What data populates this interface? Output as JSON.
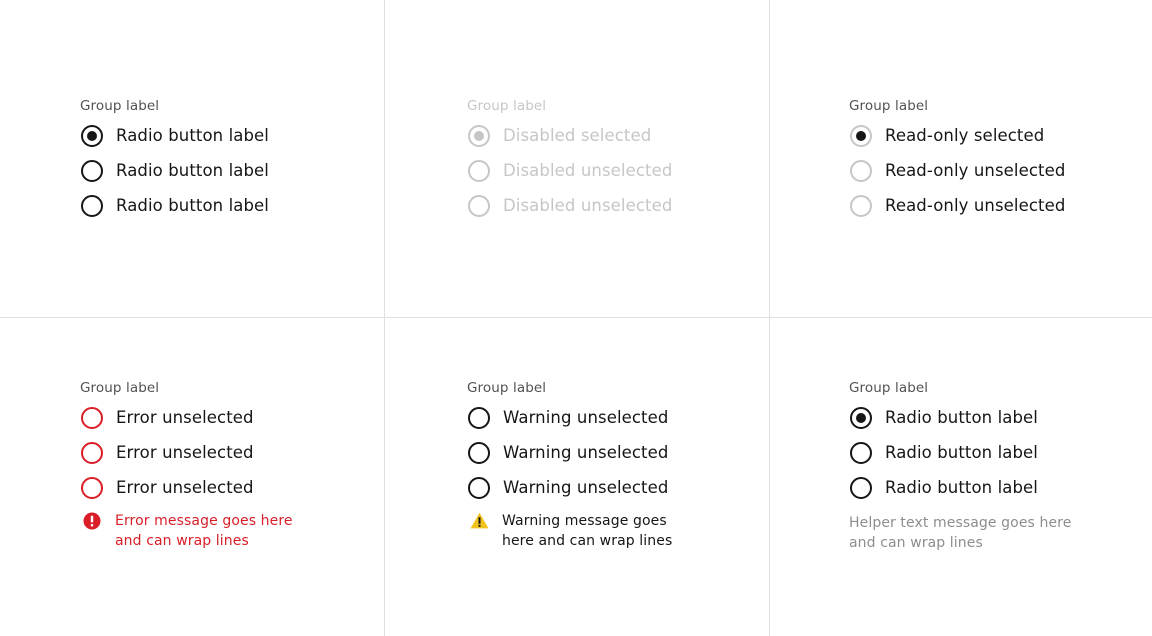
{
  "colors": {
    "text": "#161616",
    "group_label": "#525252",
    "disabled": "#c6c6c6",
    "error": "#da1e28",
    "warning": "#f1c21b",
    "helper": "#8d8d8d",
    "divider": "#e0e0e0"
  },
  "groups": [
    {
      "state": "default",
      "label": "Group label",
      "items": [
        {
          "label": "Radio button label",
          "selected": true
        },
        {
          "label": "Radio button label",
          "selected": false
        },
        {
          "label": "Radio button label",
          "selected": false
        }
      ]
    },
    {
      "state": "disabled",
      "label": "Group label",
      "items": [
        {
          "label": "Disabled selected",
          "selected": true
        },
        {
          "label": "Disabled unselected",
          "selected": false
        },
        {
          "label": "Disabled unselected",
          "selected": false
        }
      ]
    },
    {
      "state": "read-only",
      "label": "Group label",
      "items": [
        {
          "label": "Read-only selected",
          "selected": true
        },
        {
          "label": "Read-only unselected",
          "selected": false
        },
        {
          "label": "Read-only unselected",
          "selected": false
        }
      ]
    },
    {
      "state": "error",
      "label": "Group label",
      "items": [
        {
          "label": "Error unselected",
          "selected": false
        },
        {
          "label": "Error unselected",
          "selected": false
        },
        {
          "label": "Error unselected",
          "selected": false
        }
      ],
      "message": "Error message goes here and can wrap lines",
      "icon": "error-filled-icon"
    },
    {
      "state": "warning",
      "label": "Group label",
      "items": [
        {
          "label": "Warning unselected",
          "selected": false
        },
        {
          "label": "Warning unselected",
          "selected": false
        },
        {
          "label": "Warning unselected",
          "selected": false
        }
      ],
      "message": "Warning message goes here and can wrap lines",
      "icon": "warning-triangle-icon"
    },
    {
      "state": "helper",
      "label": "Group label",
      "items": [
        {
          "label": "Radio button label",
          "selected": true
        },
        {
          "label": "Radio button label",
          "selected": false
        },
        {
          "label": "Radio button label",
          "selected": false
        }
      ],
      "helper": "Helper text message goes here and can wrap lines"
    }
  ]
}
